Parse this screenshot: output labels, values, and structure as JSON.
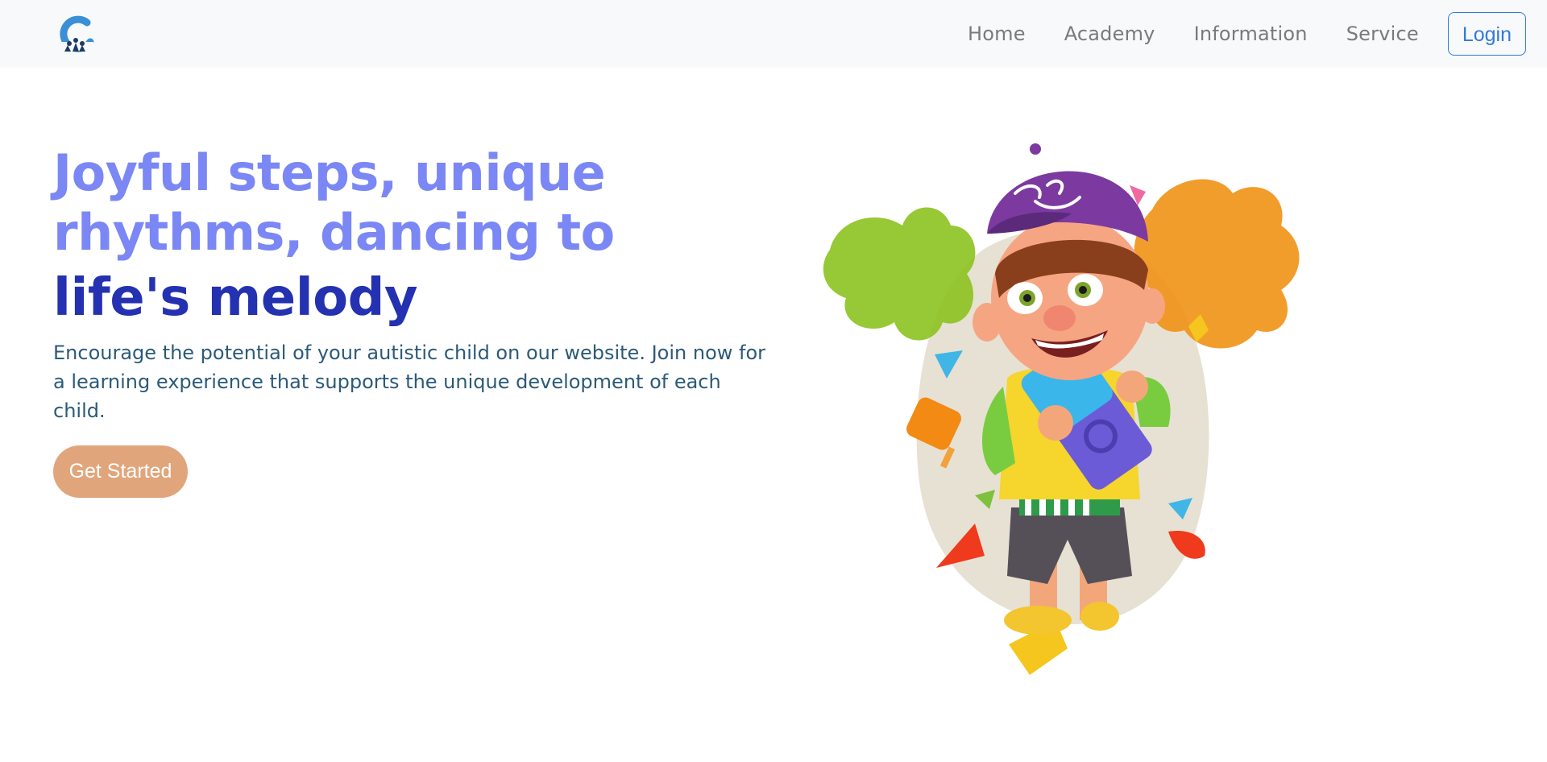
{
  "nav": {
    "logo_name": "brand-logo",
    "links": [
      "Home",
      "Academy",
      "Information",
      "Service"
    ],
    "login_label": "Login"
  },
  "hero": {
    "headline_line1": "Joyful steps, unique rhythms, dancing to",
    "headline_line2": "life's melody",
    "description": "Encourage the potential of your autistic child on our website. Join now for a learning experience that supports the unique development of each child.",
    "cta_label": "Get Started",
    "illustration": "cartoon-boy-with-puzzle-pieces"
  },
  "colors": {
    "nav_bg": "#f8f9fa",
    "headline_light": "#7b87f4",
    "headline_dark": "#2431b1",
    "body_text": "#2b5a78",
    "cta_bg": "#e1a57c",
    "login_accent": "#2f7bd9"
  }
}
